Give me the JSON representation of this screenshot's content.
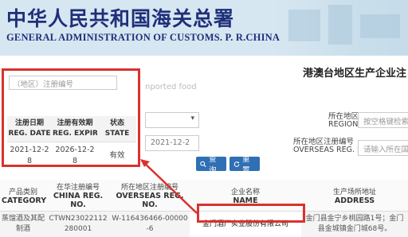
{
  "header": {
    "title_cn": "中华人民共和国海关总署",
    "title_en": "GENERAL ADMINISTRATION OF CUSTOMS. P. R.CHINA"
  },
  "page": {
    "heading": "港澳台地区生产企业注",
    "faded_en": "nported food"
  },
  "filters": {
    "select_placeholder": "",
    "region_cn": "所在地区",
    "region_en": "REGION",
    "region_placeholder": "按空格键检索定",
    "overseas_cn": "所在地区注册编号",
    "overseas_en": "OVERSEAS REG. NO.",
    "overseas_placeholder": "请输入所在国家",
    "date_value": "2021-12-2"
  },
  "buttons": {
    "search": "查询",
    "reset": "重置"
  },
  "popup": {
    "input_placeholder": "（地区）注册编号",
    "columns": [
      {
        "cn": "注册日期",
        "en": "REG. DATE"
      },
      {
        "cn": "注册有效期",
        "en": "REG. EXPIR..."
      },
      {
        "cn": "状态",
        "en": "STATE"
      }
    ],
    "row": {
      "reg_date": "2021-12-2 8",
      "expiry": "2026-12-2 8",
      "state": "有效"
    }
  },
  "table": {
    "columns": [
      {
        "cn": "产品类别",
        "en": "CATEGORY"
      },
      {
        "cn": "在华注册编号",
        "en": "CHINA REG. NO."
      },
      {
        "cn": "所在地区注册编号",
        "en": "OVERSEAS REG. NO."
      },
      {
        "cn": "企业名称",
        "en": "NAME"
      },
      {
        "cn": "生产场所地址",
        "en": "ADDRESS"
      }
    ],
    "rows": [
      {
        "category": "蒸馏酒及其配制酒",
        "china_reg": "CTWN23022112280001",
        "overseas_reg": "W-116436466-00000-6",
        "name": "金门酒厂实业股份有限公司",
        "address": "金门县金宁乡桃园路1号；金门县金城镇金门城68号。"
      }
    ]
  },
  "colors": {
    "header_blue": "#1f2f7a",
    "button_blue": "#2f6fb4",
    "highlight_red": "#d9322e"
  }
}
